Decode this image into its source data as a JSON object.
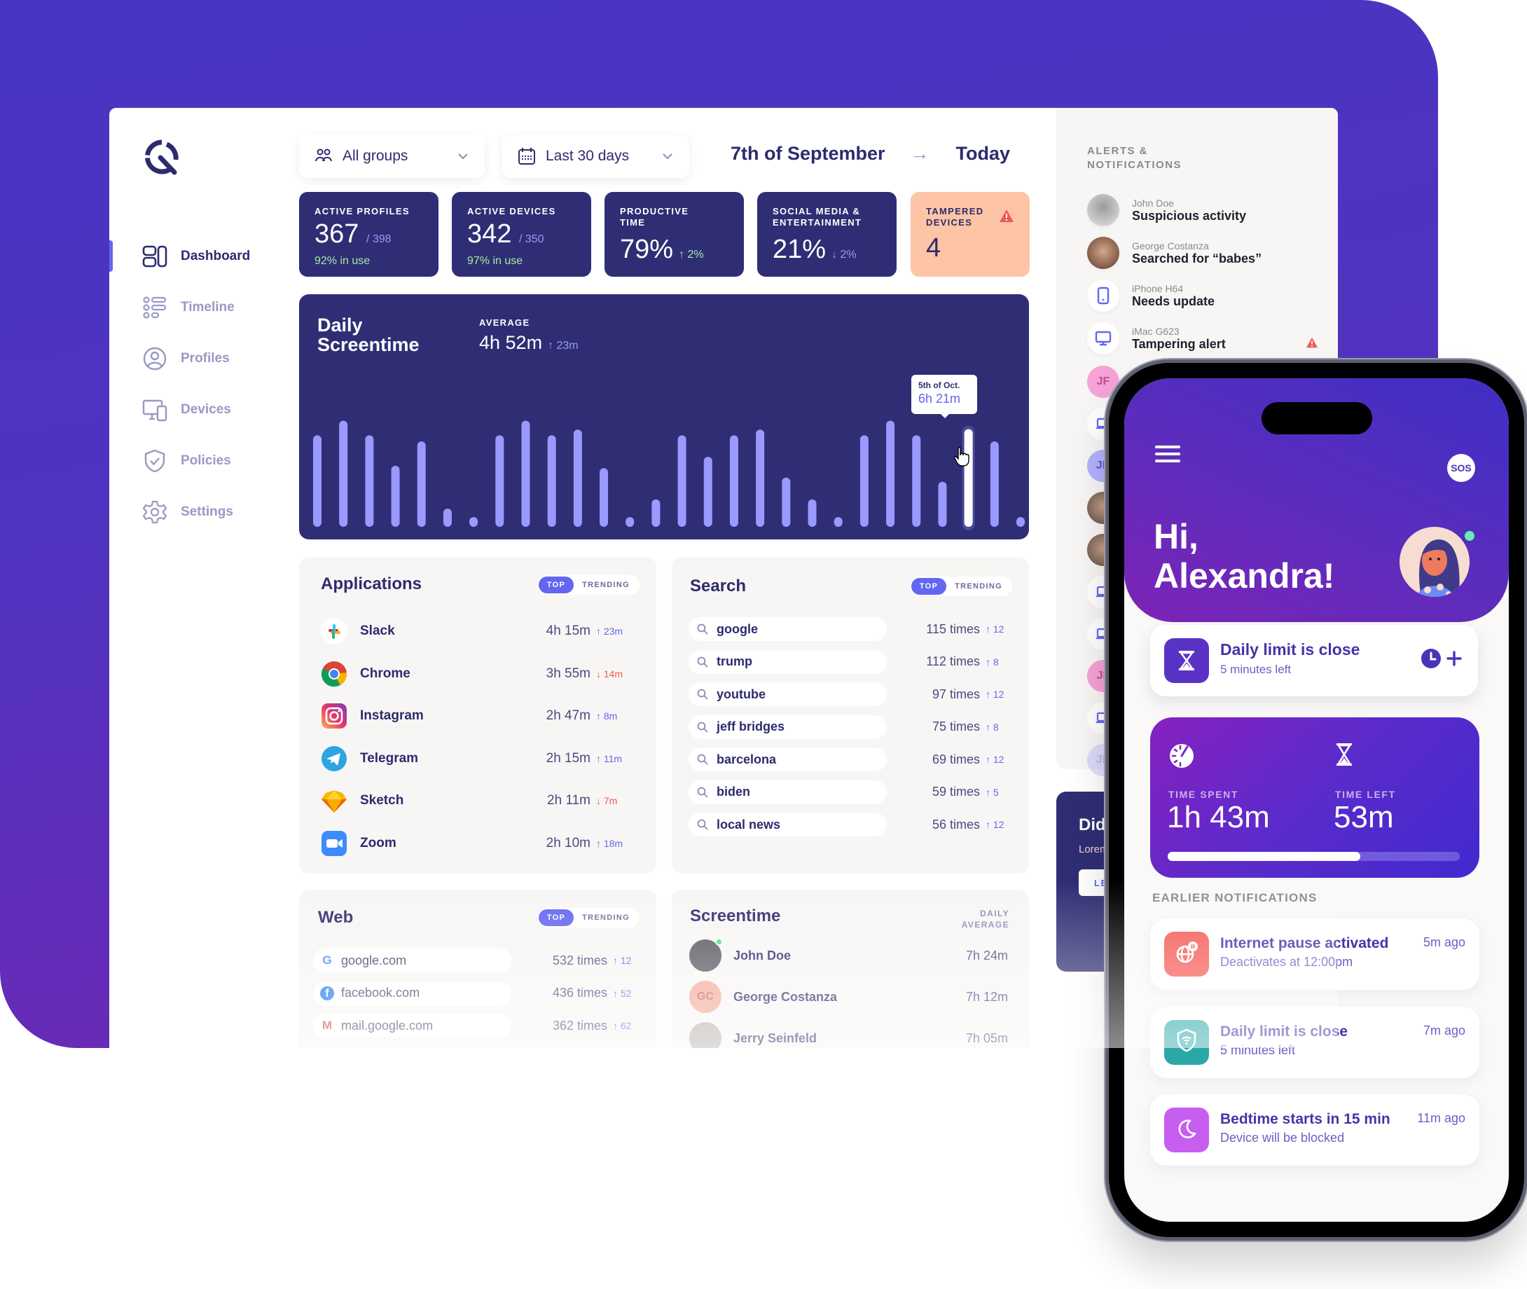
{
  "colors": {
    "backdrop_top": "#4734c2",
    "backdrop_bottom": "#7327b2",
    "navy": "#2f2e74",
    "accent": "#6366f1",
    "bar": "#9a99ff",
    "up": "#6366f1",
    "down": "#ef5a50",
    "tamper_card": "#fdc4a6"
  },
  "sidebar": {
    "items": [
      {
        "label": "Dashboard",
        "icon": "dashboard-icon",
        "active": true
      },
      {
        "label": "Timeline",
        "icon": "timeline-icon",
        "active": false
      },
      {
        "label": "Profiles",
        "icon": "profile-icon",
        "active": false
      },
      {
        "label": "Devices",
        "icon": "devices-icon",
        "active": false
      },
      {
        "label": "Policies",
        "icon": "shield-check-icon",
        "active": false
      },
      {
        "label": "Settings",
        "icon": "gear-icon",
        "active": false
      }
    ]
  },
  "filters": {
    "group": "All groups",
    "period": "Last 30 days",
    "date_from": "7th of September",
    "date_to": "Today"
  },
  "stats": {
    "active_profiles": {
      "label": "Active profiles",
      "value": "367",
      "total": "/ 398",
      "note": "92% in use"
    },
    "active_devices": {
      "label": "Active devices",
      "value": "342",
      "total": "/ 350",
      "note": "97% in use"
    },
    "productive_time": {
      "label": "Productive time",
      "value": "79%",
      "delta": "↑ 2%"
    },
    "social_media": {
      "label": "Social media & entertainment",
      "value": "21%",
      "delta": "↓ 2%"
    },
    "tampered_devices": {
      "label": "Tampered devices",
      "value": "4"
    }
  },
  "chart_data": {
    "type": "bar",
    "title": "Daily Screentime",
    "average_label": "Average",
    "average": "4h 52m",
    "average_delta": "↑ 23m",
    "unit": "minutes",
    "values": [
      357,
      414,
      357,
      238,
      333,
      71,
      38,
      357,
      414,
      357,
      379,
      229,
      38,
      107,
      357,
      273,
      357,
      379,
      192,
      107,
      38,
      357,
      414,
      357,
      176,
      381,
      333,
      38
    ],
    "highlight_index": 25,
    "tooltip": {
      "date": "5th of Oct.",
      "value": "6h 21m"
    },
    "ylim": [
      0,
      420
    ],
    "grid": false
  },
  "toggle": {
    "top": "Top",
    "trending": "Trending"
  },
  "applications": {
    "title": "Applications",
    "items": [
      {
        "name": "Slack",
        "time": "4h 15m",
        "delta": "23m",
        "dir": "up",
        "icon": "slack-icon"
      },
      {
        "name": "Chrome",
        "time": "3h 55m",
        "delta": "14m",
        "dir": "down",
        "icon": "chrome-icon"
      },
      {
        "name": "Instagram",
        "time": "2h 47m",
        "delta": "8m",
        "dir": "up",
        "icon": "instagram-icon"
      },
      {
        "name": "Telegram",
        "time": "2h 15m",
        "delta": "11m",
        "dir": "up",
        "icon": "telegram-icon"
      },
      {
        "name": "Sketch",
        "time": "2h 11m",
        "delta": "7m",
        "dir": "down",
        "icon": "sketch-icon"
      },
      {
        "name": "Zoom",
        "time": "2h 10m",
        "delta": "18m",
        "dir": "up",
        "icon": "zoom-icon"
      }
    ]
  },
  "search": {
    "title": "Search",
    "items": [
      {
        "query": "google",
        "count": "115 times",
        "delta": "12"
      },
      {
        "query": "trump",
        "count": "112 times",
        "delta": "8"
      },
      {
        "query": "youtube",
        "count": "97 times",
        "delta": "12"
      },
      {
        "query": "jeff bridges",
        "count": "75 times",
        "delta": "8"
      },
      {
        "query": "barcelona",
        "count": "69 times",
        "delta": "12"
      },
      {
        "query": "biden",
        "count": "59 times",
        "delta": "5"
      },
      {
        "query": "local news",
        "count": "56 times",
        "delta": "12"
      }
    ]
  },
  "web": {
    "title": "Web",
    "items": [
      {
        "site": "google.com",
        "count": "532 times",
        "delta": "12",
        "icon": "google-icon"
      },
      {
        "site": "facebook.com",
        "count": "436 times",
        "delta": "52",
        "icon": "facebook-icon"
      },
      {
        "site": "mail.google.com",
        "count": "362 times",
        "delta": "62",
        "icon": "gmail-icon"
      }
    ]
  },
  "screentime": {
    "title": "Screentime",
    "subtitle": "Daily average",
    "items": [
      {
        "name": "John Doe",
        "time": "7h 24m",
        "initials": "",
        "online": true
      },
      {
        "name": "George Costanza",
        "time": "7h 12m",
        "initials": "GC",
        "online": false
      },
      {
        "name": "Jerry Seinfeld",
        "time": "7h 05m",
        "initials": "",
        "online": false
      }
    ]
  },
  "alerts": {
    "title": "Alerts & Notifications",
    "items": [
      {
        "who": "John Doe",
        "what": "Suspicious activity",
        "type": "avatar"
      },
      {
        "who": "George Costanza",
        "what": "Searched for “babes”",
        "type": "avatar"
      },
      {
        "who": "iPhone H64",
        "what": "Needs update",
        "type": "phone"
      },
      {
        "who": "iMac G623",
        "what": "Tampering alert",
        "type": "desktop",
        "warning": true
      }
    ],
    "more": [
      "JF",
      "laptop",
      "JD",
      "avatar",
      "avatar",
      "tablet",
      "desktop",
      "JF",
      "laptop",
      "JD"
    ]
  },
  "promo": {
    "title": "Did",
    "body": "Lorem conse sed d incidi",
    "button": "LEA"
  },
  "phone": {
    "sos": "SOS",
    "greeting_line1": "Hi,",
    "greeting_line2": "Alexandra!",
    "limit_card": {
      "title": "Daily limit is close",
      "subtitle": "5 minutes left"
    },
    "usage": {
      "spent_label": "Time spent",
      "spent": "1h 43m",
      "left_label": "Time left",
      "left": "53m",
      "progress": 0.66
    },
    "earlier_label": "Earlier notifications",
    "notifications": [
      {
        "title": "Internet pause activated",
        "subtitle": "Deactivates at 12:00pm",
        "ago": "5m ago",
        "color": "#f65c55",
        "icon": "globe-pause-icon"
      },
      {
        "title": "Daily limit is close",
        "subtitle": "5 minutes left",
        "ago": "7m ago",
        "color": "#2aa8a8",
        "icon": "shield-wifi-icon"
      },
      {
        "title": "Bedtime starts in 15 min",
        "subtitle": "Device will be blocked",
        "ago": "11m ago",
        "color": "#c65ef0",
        "icon": "moon-icon"
      }
    ]
  }
}
